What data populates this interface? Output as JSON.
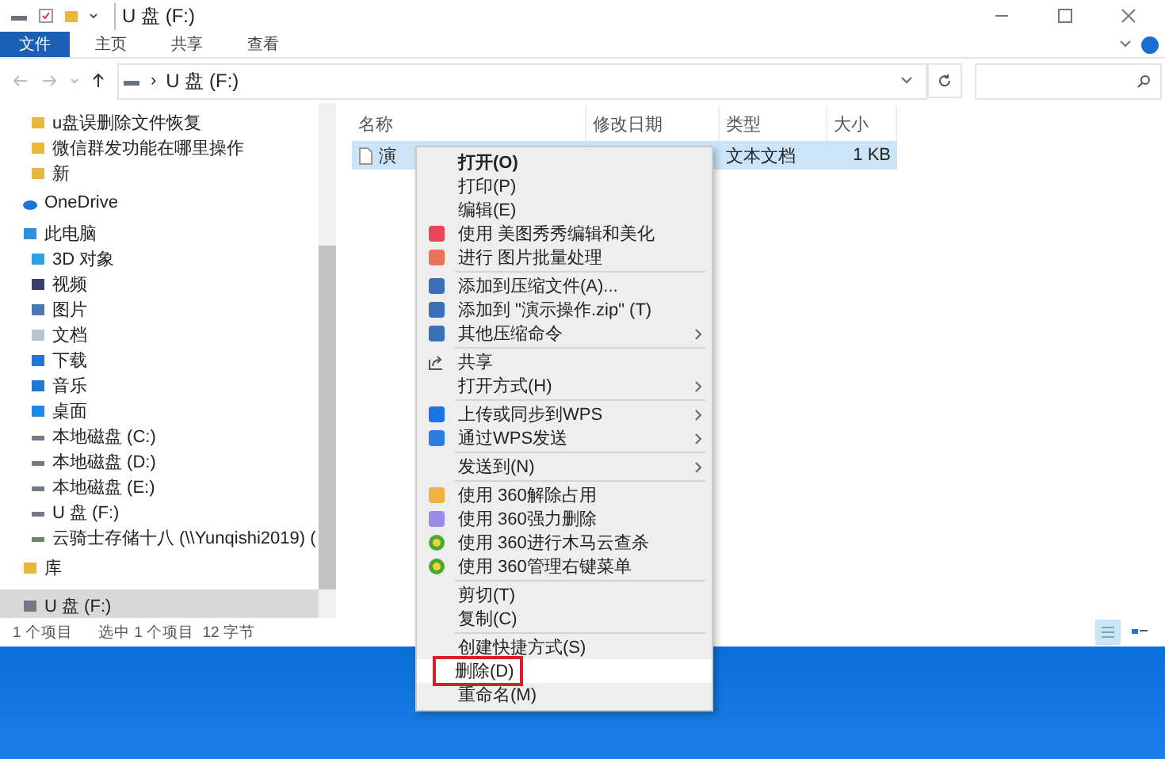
{
  "window": {
    "title": "U 盘 (F:)"
  },
  "ribbon_tabs": [
    {
      "label": "文件",
      "selected": true
    },
    {
      "label": "主页",
      "selected": false
    },
    {
      "label": "共享",
      "selected": false
    },
    {
      "label": "查看",
      "selected": false
    }
  ],
  "address": {
    "separator": "›",
    "location": "U 盘 (F:)"
  },
  "nav": [
    {
      "label": "u盘误删除文件恢复",
      "kind": "folder",
      "selected": false
    },
    {
      "label": "微信群发功能在哪里操作",
      "kind": "folder",
      "selected": false
    },
    {
      "label": "新",
      "kind": "folder",
      "selected": false
    },
    {
      "label": "OneDrive",
      "kind": "cloud",
      "selected": false
    },
    {
      "label": "此电脑",
      "kind": "pc",
      "selected": false,
      "children": [
        {
          "label": "3D 对象",
          "kind": "cube",
          "selected": false
        },
        {
          "label": "视频",
          "kind": "video",
          "selected": false
        },
        {
          "label": "图片",
          "kind": "picture",
          "selected": false
        },
        {
          "label": "文档",
          "kind": "doc",
          "selected": false
        },
        {
          "label": "下载",
          "kind": "download",
          "selected": false
        },
        {
          "label": "音乐",
          "kind": "music",
          "selected": false
        },
        {
          "label": "桌面",
          "kind": "desktop",
          "selected": false
        },
        {
          "label": "本地磁盘 (C:)",
          "kind": "drive",
          "selected": false
        },
        {
          "label": "本地磁盘 (D:)",
          "kind": "drive",
          "selected": false
        },
        {
          "label": "本地磁盘 (E:)",
          "kind": "drive",
          "selected": false
        },
        {
          "label": "U 盘 (F:)",
          "kind": "drive",
          "selected": false
        },
        {
          "label": "云骑士存储十八 (\\\\Yunqishi2019) (",
          "kind": "netdrive",
          "selected": false
        }
      ]
    },
    {
      "label": "库",
      "kind": "library",
      "selected": false
    },
    {
      "label": "U 盘 (F:)",
      "kind": "drive",
      "selected": true
    }
  ],
  "table": {
    "columns": [
      "名称",
      "修改日期",
      "类型",
      "大小"
    ],
    "rows": [
      {
        "name": "演",
        "type": "文本文档",
        "size": "1 KB",
        "selected": true
      }
    ]
  },
  "status_bar": {
    "count": "1 个项目",
    "selection": "选中 1 个项目  12 字节"
  },
  "context_menu": [
    {
      "kind": "plain",
      "label": "打开(O)",
      "bold": true,
      "submenu": false,
      "selected": false,
      "outlined": false
    },
    {
      "kind": "plain",
      "label": "打印(P)",
      "bold": false,
      "submenu": false,
      "selected": false,
      "outlined": false
    },
    {
      "kind": "plain",
      "label": "编辑(E)",
      "bold": false,
      "submenu": false,
      "selected": false,
      "outlined": false
    },
    {
      "kind": "meitu",
      "label": "使用 美图秀秀编辑和美化",
      "bold": false,
      "submenu": false,
      "selected": false,
      "outlined": false
    },
    {
      "kind": "batch",
      "label": "进行 图片批量处理",
      "bold": false,
      "submenu": false,
      "selected": false,
      "outlined": false
    },
    {
      "kind": "separator"
    },
    {
      "kind": "archive",
      "label": "添加到压缩文件(A)...",
      "bold": false,
      "submenu": false,
      "selected": false,
      "outlined": false
    },
    {
      "kind": "archive",
      "label": "添加到 \"演示操作.zip\" (T)",
      "bold": false,
      "submenu": false,
      "selected": false,
      "outlined": false
    },
    {
      "kind": "archive",
      "label": "其他压缩命令",
      "bold": false,
      "submenu": true,
      "selected": false,
      "outlined": false
    },
    {
      "kind": "separator"
    },
    {
      "kind": "share",
      "label": "共享",
      "bold": false,
      "submenu": false,
      "selected": false,
      "outlined": false
    },
    {
      "kind": "plain",
      "label": "打开方式(H)",
      "bold": false,
      "submenu": true,
      "selected": false,
      "outlined": false
    },
    {
      "kind": "separator"
    },
    {
      "kind": "cloud",
      "label": "上传或同步到WPS",
      "bold": false,
      "submenu": true,
      "selected": false,
      "outlined": false
    },
    {
      "kind": "send",
      "label": "通过WPS发送",
      "bold": false,
      "submenu": true,
      "selected": false,
      "outlined": false
    },
    {
      "kind": "separator"
    },
    {
      "kind": "plain",
      "label": "发送到(N)",
      "bold": false,
      "submenu": true,
      "selected": false,
      "outlined": false
    },
    {
      "kind": "separator"
    },
    {
      "kind": "unlock",
      "label": "使用 360解除占用",
      "bold": false,
      "submenu": false,
      "selected": false,
      "outlined": false
    },
    {
      "kind": "shred",
      "label": "使用 360强力删除",
      "bold": false,
      "submenu": false,
      "selected": false,
      "outlined": false
    },
    {
      "kind": "shield",
      "label": "使用 360进行木马云查杀",
      "bold": false,
      "submenu": false,
      "selected": false,
      "outlined": false
    },
    {
      "kind": "shield",
      "label": "使用 360管理右键菜单",
      "bold": false,
      "submenu": false,
      "selected": false,
      "outlined": false
    },
    {
      "kind": "separator"
    },
    {
      "kind": "plain",
      "label": "剪切(T)",
      "bold": false,
      "submenu": false,
      "selected": false,
      "outlined": false
    },
    {
      "kind": "plain",
      "label": "复制(C)",
      "bold": false,
      "submenu": false,
      "selected": false,
      "outlined": false
    },
    {
      "kind": "separator"
    },
    {
      "kind": "plain",
      "label": "创建快捷方式(S)",
      "bold": false,
      "submenu": false,
      "selected": false,
      "outlined": false
    },
    {
      "kind": "plain",
      "label": "删除(D)",
      "bold": false,
      "submenu": false,
      "selected": true,
      "outlined": true
    },
    {
      "kind": "plain",
      "label": "重命名(M)",
      "bold": false,
      "submenu": false,
      "selected": false,
      "outlined": false
    }
  ]
}
